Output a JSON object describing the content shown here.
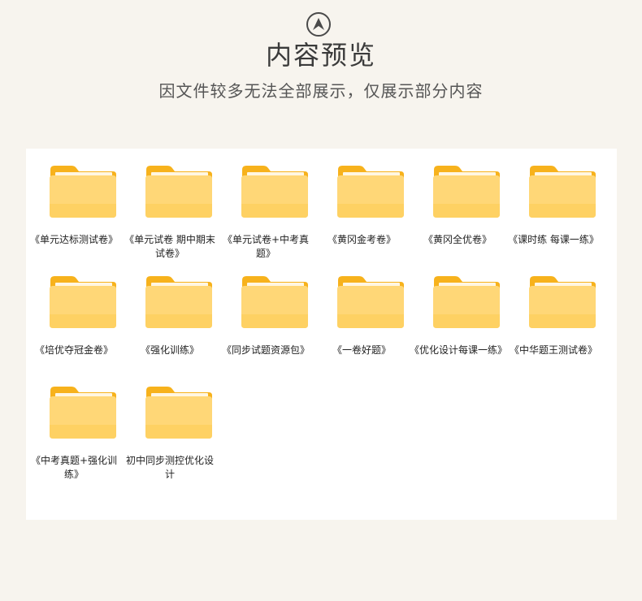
{
  "header": {
    "logo_icon": "upward-arrow-circle-icon",
    "title": "内容预览",
    "subtitle": "因文件较多无法全部展示，仅展示部分内容"
  },
  "folder_icon": "folder-icon",
  "colors": {
    "background": "#f7f4ee",
    "panel": "#ffffff",
    "folder_back": "#f7b21c",
    "folder_front": "#ffd777"
  },
  "items": [
    {
      "label": "《单元达标测试卷》"
    },
    {
      "label": "《单元试卷 期中期末试卷》"
    },
    {
      "label": "《单元试卷+中考真题》"
    },
    {
      "label": "《黄冈金考卷》"
    },
    {
      "label": "《黄冈全优卷》"
    },
    {
      "label": "《课时练 每课一练》"
    },
    {
      "label": "《培优夺冠金卷》"
    },
    {
      "label": "《强化训练》"
    },
    {
      "label": "《同步试题资源包》"
    },
    {
      "label": "《一卷好题》"
    },
    {
      "label": "《优化设计每课一练》"
    },
    {
      "label": "《中华题王测试卷》"
    },
    {
      "label": "《中考真题+强化训练》"
    },
    {
      "label": "初中同步测控优化设计"
    }
  ]
}
